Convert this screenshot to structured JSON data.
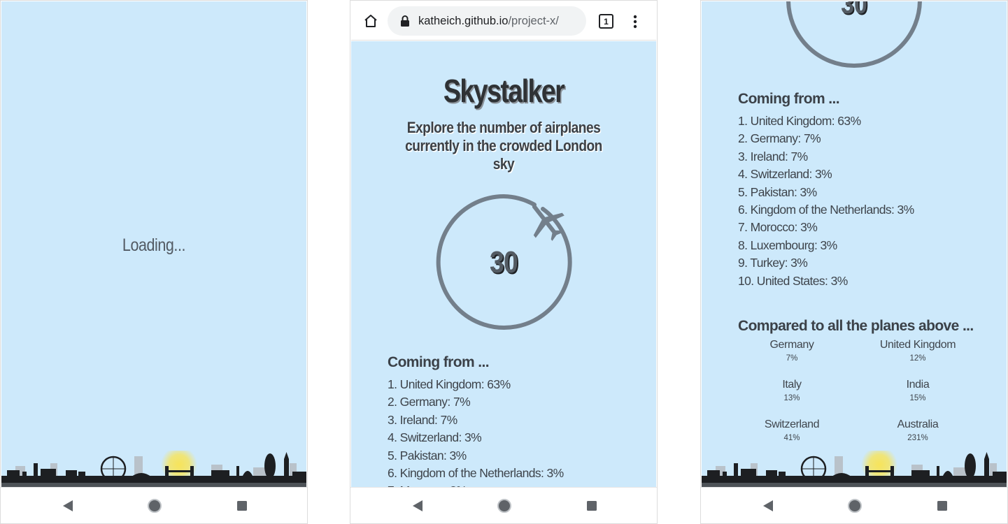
{
  "screen1": {
    "loading_text": "Loading..."
  },
  "browser": {
    "url_domain": "katheich.github.io",
    "url_path": "/project-x/",
    "tab_count": "1"
  },
  "app": {
    "title": "Skystalker",
    "subtitle_line1": "Explore the number of airplanes",
    "subtitle_line2": "currently in the crowded London sky",
    "plane_count": "30"
  },
  "origins": {
    "heading": "Coming from ...",
    "items": [
      "1. United Kingdom: 63%",
      "2. Germany: 7%",
      "3. Ireland: 7%",
      "4. Switzerland: 3%",
      "5. Pakistan: 3%",
      "6. Kingdom of the Netherlands: 3%",
      "7. Morocco: 3%",
      "8. Luxembourg: 3%",
      "9. Turkey: 3%",
      "10. United States: 3%"
    ]
  },
  "compare": {
    "heading": "Compared to all the planes above ...",
    "items": [
      {
        "country": "Germany",
        "percent": "7%"
      },
      {
        "country": "United Kingdom",
        "percent": "12%"
      },
      {
        "country": "Italy",
        "percent": "13%"
      },
      {
        "country": "India",
        "percent": "15%"
      },
      {
        "country": "Switzerland",
        "percent": "41%"
      },
      {
        "country": "Australia",
        "percent": "231%"
      }
    ]
  },
  "colors": {
    "sky": "#cde9fb",
    "ring": "#737f8b",
    "text_dark": "#2f3235",
    "sun": "#f7e45a"
  },
  "icons": {
    "nav_back": "triangle-back-icon",
    "nav_home": "circle-home-icon",
    "nav_recents": "square-recents-icon",
    "browser_home": "house-icon",
    "lock": "lock-icon",
    "menu": "kebab-menu-icon",
    "plane": "airplane-icon"
  }
}
